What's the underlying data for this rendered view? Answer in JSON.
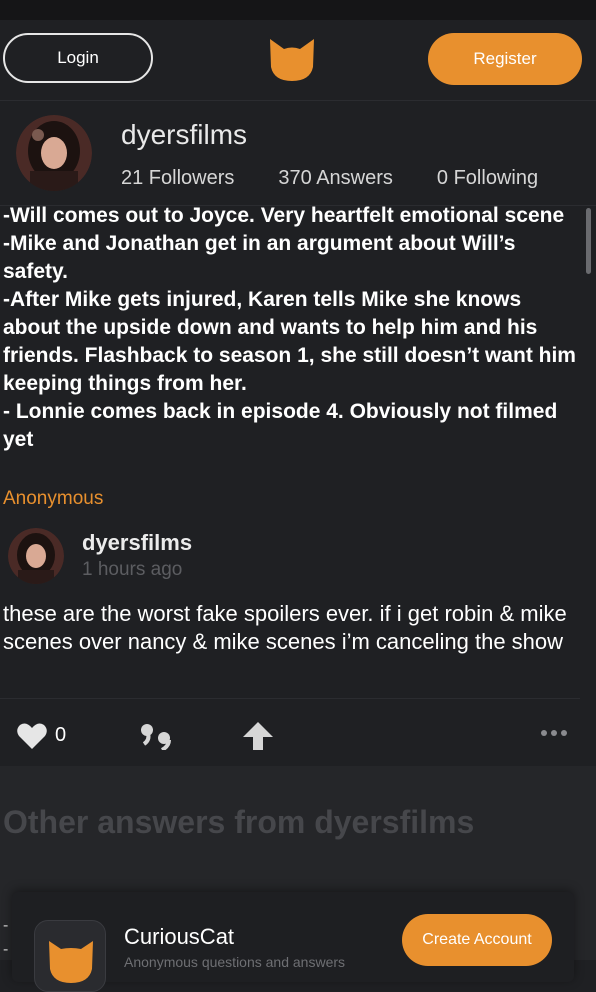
{
  "colors": {
    "accent": "#e8902e",
    "background": "#1f2023",
    "muted": "#5c5d61"
  },
  "header": {
    "login_label": "Login",
    "register_label": "Register",
    "logo_icon": "cat-logo-icon"
  },
  "profile": {
    "username": "dyersfilms",
    "followers": "21 Followers",
    "answers": "370 Answers",
    "following": "0 Following"
  },
  "question": {
    "text": "-Will comes out to Joyce. Very heartfelt emotional scene\n-Mike and Jonathan get in an argument about Will’s safety.\n-After Mike gets injured, Karen tells Mike she knows about the upside down and wants to help him and his friends. Flashback to season 1, she still doesn’t want him keeping things from her.\n- Lonnie comes back in episode 4. Obviously not filmed yet",
    "asker": "Anonymous"
  },
  "answer": {
    "username": "dyersfilms",
    "time": "1 hours ago",
    "text": "these are the worst fake spoilers ever. if i get robin & mike scenes over nancy & mike scenes i’m canceling the show",
    "like_count": "0"
  },
  "other": {
    "title": "Other answers from dyersfilms",
    "side_marks": "-\n-"
  },
  "banner": {
    "title": "CuriousCat",
    "subtitle": "Anonymous questions and answers",
    "cta_label": "Create Account"
  }
}
